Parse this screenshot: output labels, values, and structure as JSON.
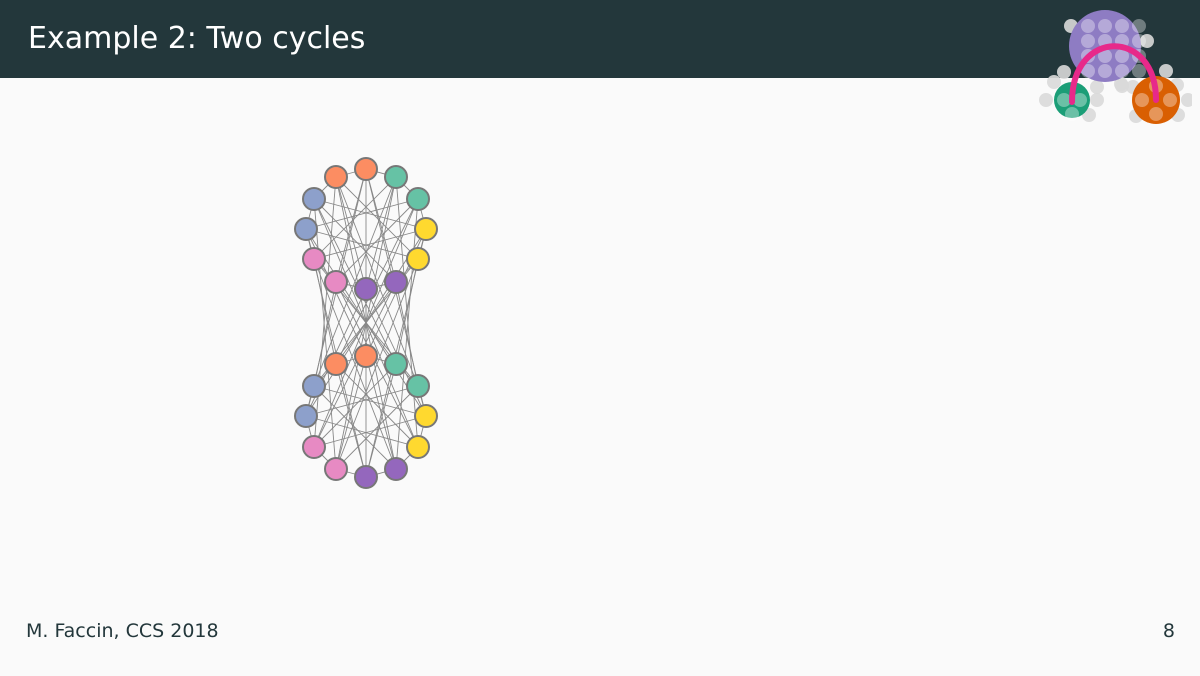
{
  "slide": {
    "title": "Example 2: Two cycles",
    "footer_author": "M. Faccin, CCS 2018",
    "page_number": "8"
  },
  "logo": {
    "icon": "community-network-logo-icon",
    "colors": {
      "large_community": "#8e7cc3",
      "left_community": "#1b9e77",
      "right_community": "#d95f02",
      "link": "#e7298a",
      "faded_node": "#d9d9d9"
    }
  },
  "graph": {
    "node_stroke": "#777777",
    "edge_color": "#888888",
    "palette": {
      "orange": "#fc8d62",
      "teal": "#66c2a5",
      "blue": "#8da0cb",
      "pink": "#e78ac3",
      "yellow": "#ffd92f",
      "purple": "#9467bd"
    },
    "node_colors": [
      "orange",
      "orange",
      "teal",
      "teal",
      "yellow",
      "yellow",
      "purple",
      "purple",
      "pink",
      "pink",
      "blue",
      "blue",
      "orange",
      "orange",
      "teal",
      "teal",
      "yellow",
      "yellow",
      "purple",
      "purple",
      "pink",
      "pink",
      "blue",
      "blue"
    ]
  }
}
